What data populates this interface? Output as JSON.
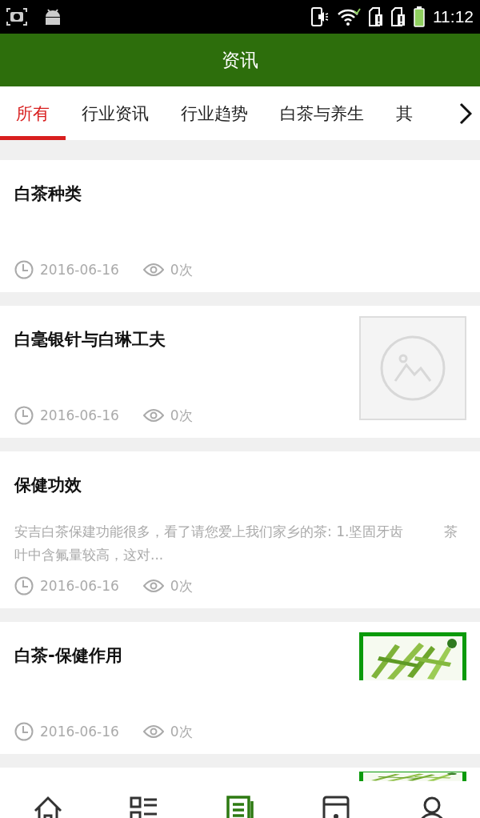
{
  "status_bar": {
    "time": "11:12"
  },
  "header": {
    "title": "资讯"
  },
  "tabs": [
    {
      "label": "所有",
      "selected": true
    },
    {
      "label": "行业资讯",
      "selected": false
    },
    {
      "label": "行业趋势",
      "selected": false
    },
    {
      "label": "白茶与养生",
      "selected": false
    },
    {
      "label": "其",
      "selected": false
    }
  ],
  "articles": [
    {
      "title": "白茶种类",
      "date": "2016-06-16",
      "views": "0次",
      "kind": "text"
    },
    {
      "title": "白毫银针与白琳工夫",
      "date": "2016-06-16",
      "views": "0次",
      "kind": "placeholder"
    },
    {
      "title": "保健功效",
      "excerpt": "安吉白茶保建功能很多，看了请您爱上我们家乡的茶: 1.坚固牙齿　　　茶叶中含氟量较高，这对...",
      "date": "2016-06-16",
      "views": "0次",
      "kind": "text"
    },
    {
      "title": "白茶-保健作用",
      "date": "2016-06-16",
      "views": "0次",
      "kind": "picture"
    }
  ],
  "bottom_nav": [
    {
      "kind": "home",
      "selected": false
    },
    {
      "kind": "list",
      "selected": false
    },
    {
      "kind": "news",
      "selected": true
    },
    {
      "kind": "store",
      "selected": false
    },
    {
      "kind": "person",
      "selected": false
    }
  ]
}
